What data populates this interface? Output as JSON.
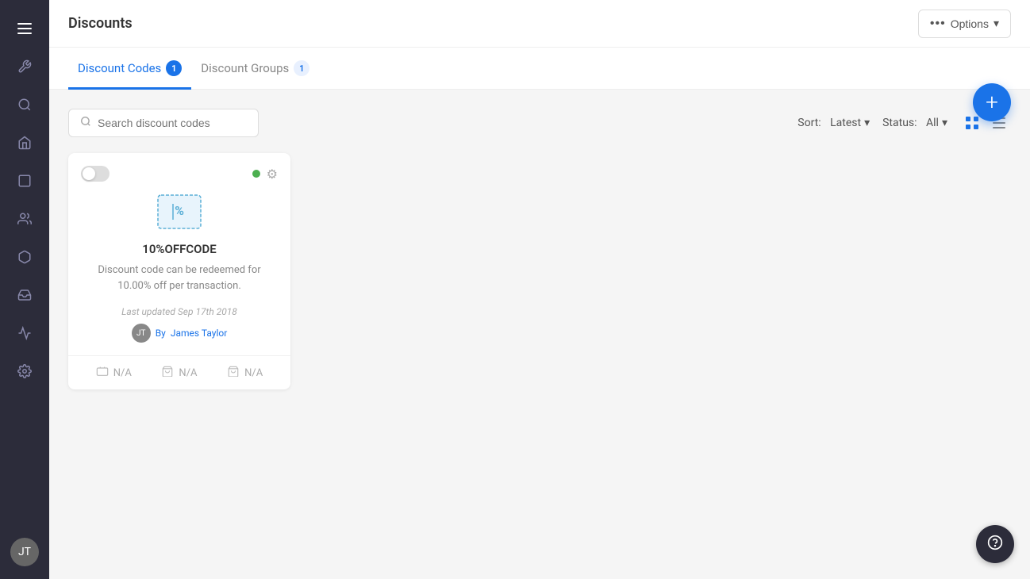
{
  "sidebar": {
    "icons": [
      {
        "name": "menu-icon",
        "symbol": "☰"
      },
      {
        "name": "tools-icon",
        "symbol": "✕"
      },
      {
        "name": "search-icon",
        "symbol": "🔍"
      },
      {
        "name": "home-icon",
        "symbol": "⌂"
      },
      {
        "name": "pages-icon",
        "symbol": "▭"
      },
      {
        "name": "people-icon",
        "symbol": "👥"
      },
      {
        "name": "box-icon",
        "symbol": "⬡"
      },
      {
        "name": "inbox-icon",
        "symbol": "▤"
      },
      {
        "name": "analytics-icon",
        "symbol": "📈"
      },
      {
        "name": "settings-icon",
        "symbol": "⚙"
      }
    ],
    "avatar_initial": "JT"
  },
  "header": {
    "title": "Discounts",
    "options_label": "Options"
  },
  "tabs": [
    {
      "id": "discount-codes",
      "label": "Discount Codes",
      "badge": "1",
      "active": true
    },
    {
      "id": "discount-groups",
      "label": "Discount Groups",
      "badge": "1",
      "active": false
    }
  ],
  "toolbar": {
    "search_placeholder": "Search discount codes",
    "sort_label": "Sort:",
    "sort_value": "Latest",
    "status_label": "Status:",
    "status_value": "All"
  },
  "card": {
    "title": "10%OFFCODE",
    "description": "Discount code can be redeemed for 10.00% off per transaction.",
    "last_updated_label": "Last updated",
    "last_updated_date": "Sep 17th 2018",
    "author_by": "By",
    "author_name": "James Taylor",
    "stats": [
      {
        "name": "stat-uses",
        "value": "N/A"
      },
      {
        "name": "stat-orders",
        "value": "N/A"
      },
      {
        "name": "stat-revenue",
        "value": "N/A"
      }
    ]
  },
  "fab": {
    "label": "+"
  },
  "colors": {
    "accent": "#1a73e8",
    "sidebar_bg": "#2c2c3a",
    "status_active": "#4caf50"
  }
}
